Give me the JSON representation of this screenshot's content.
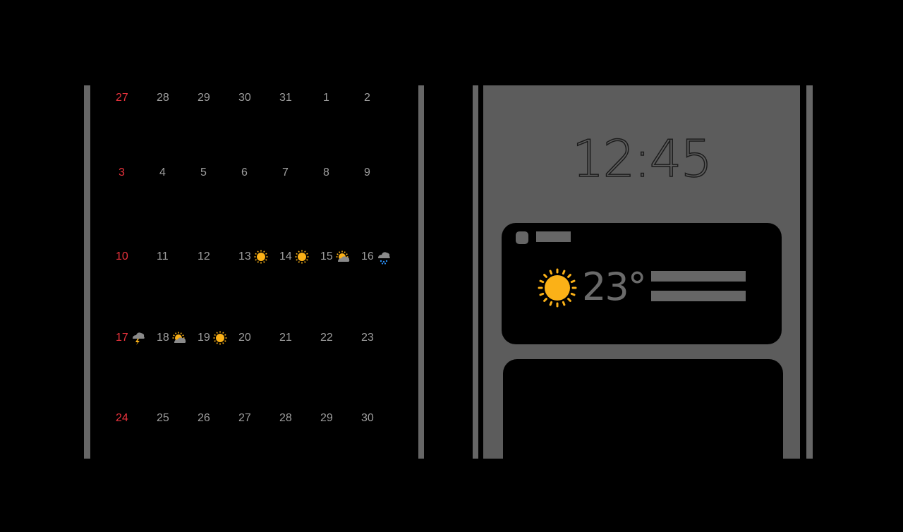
{
  "colors": {
    "background": "#000000",
    "frame": "#666666",
    "sunday": "#e8323c",
    "date": "#9e9e9e",
    "sun": "#fbb117",
    "rain": "#2a8df4"
  },
  "calendar": {
    "weeks": [
      [
        {
          "day": "27"
        },
        {
          "day": "28"
        },
        {
          "day": "29"
        },
        {
          "day": "30"
        },
        {
          "day": "31"
        },
        {
          "day": "1"
        },
        {
          "day": "2"
        }
      ],
      [
        {
          "day": "3"
        },
        {
          "day": "4"
        },
        {
          "day": "5"
        },
        {
          "day": "6"
        },
        {
          "day": "7"
        },
        {
          "day": "8"
        },
        {
          "day": "9"
        }
      ],
      [
        {
          "day": "10"
        },
        {
          "day": "11"
        },
        {
          "day": "12"
        },
        {
          "day": "13",
          "weather": "sunny-icon"
        },
        {
          "day": "14",
          "weather": "sunny-icon"
        },
        {
          "day": "15",
          "weather": "partly-cloudy-icon"
        },
        {
          "day": "16",
          "weather": "rain-icon"
        }
      ],
      [
        {
          "day": "17",
          "weather": "thunderstorm-icon"
        },
        {
          "day": "18",
          "weather": "partly-cloudy-icon"
        },
        {
          "day": "19",
          "weather": "sunny-icon"
        },
        {
          "day": "20"
        },
        {
          "day": "21"
        },
        {
          "day": "22"
        },
        {
          "day": "23"
        }
      ],
      [
        {
          "day": "24"
        },
        {
          "day": "25"
        },
        {
          "day": "26"
        },
        {
          "day": "27"
        },
        {
          "day": "28"
        },
        {
          "day": "29"
        },
        {
          "day": "30"
        }
      ]
    ]
  },
  "phone": {
    "clock": "12:45",
    "weather_card": {
      "temperature": "23°",
      "icon": "sunny-icon"
    }
  }
}
